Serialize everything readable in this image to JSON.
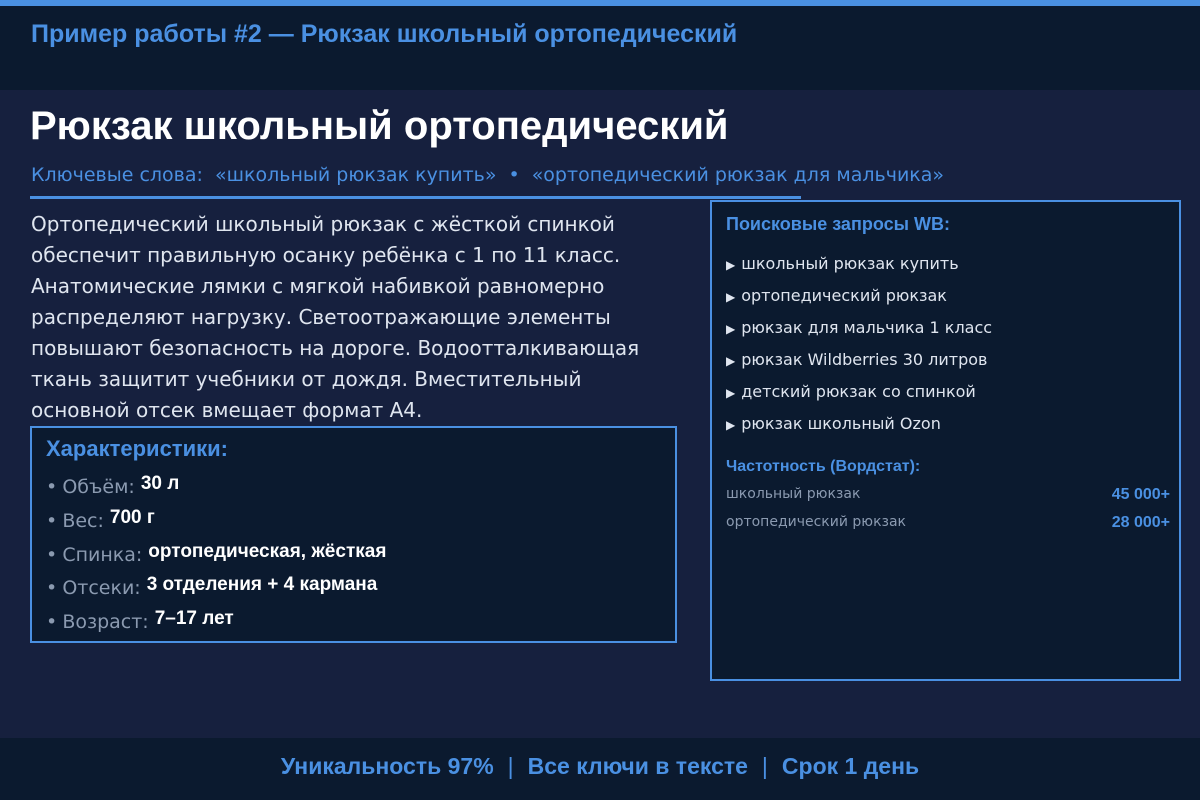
{
  "header": {
    "title": "Пример работы #2 — Рюкзак школьный ортопедический"
  },
  "main": {
    "title": "Рюкзак школьный ортопедический",
    "keywords_label": "Ключевые слова:",
    "keywords": [
      "«школьный рюкзак купить»",
      "«ортопедический рюкзак для мальчика»"
    ],
    "keyword_separator": "•",
    "description_lines": [
      "Ортопедический школьный рюкзак с жёсткой спинкой",
      "обеспечит правильную осанку ребёнка с 1 по 11 класс.",
      "Анатомические лямки с мягкой набивкой равномерно",
      "распределяют нагрузку. Светоотражающие элементы",
      "повышают безопасность на дороге. Водоотталкивающая",
      "ткань защитит учебники от дождя. Вместительный",
      "основной отсек вмещает формат А4."
    ]
  },
  "specs": {
    "title": "Характеристики:",
    "bullet": "•",
    "items": [
      {
        "label": "Объём:",
        "value": "30 л"
      },
      {
        "label": "Вес:",
        "value": "700 г"
      },
      {
        "label": "Спинка:",
        "value": "ортопедическая, жёсткая"
      },
      {
        "label": "Отсеки:",
        "value": "3 отделения + 4 кармана"
      },
      {
        "label": "Возраст:",
        "value": "7–17 лет"
      }
    ]
  },
  "search_panel": {
    "title": "Поисковые запросы WB:",
    "arrow": "▶",
    "queries": [
      "школьный рюкзак купить",
      "ортопедический рюкзак",
      "рюкзак для мальчика 1 класс",
      "рюкзак Wildberries 30 литров",
      "детский рюкзак со спинкой",
      "рюкзак школьный Ozon"
    ],
    "frequency_title": "Частотность (Вордстат):",
    "frequency": [
      {
        "term": "школьный рюкзак",
        "count": "45 000+"
      },
      {
        "term": "ортопедический рюкзак",
        "count": "28 000+"
      }
    ]
  },
  "footer": {
    "items": [
      "Уникальность 97%",
      "Все ключи в тексте",
      "Срок 1 день"
    ],
    "separator": "|"
  },
  "colors": {
    "accent": "#4a90e2",
    "background": "#16203e",
    "panel": "#0b1a2f",
    "text": "#ffffff",
    "muted": "#8b9ab0"
  }
}
